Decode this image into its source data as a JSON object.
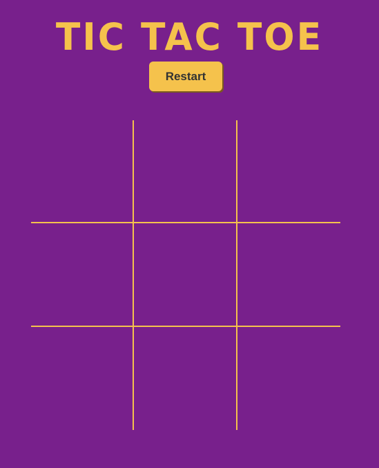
{
  "header": {
    "title": "TIC TAC TOE",
    "restart_label": "Restart"
  },
  "board": {
    "cells": [
      "",
      "",
      "",
      "",
      "",
      "",
      "",
      "",
      ""
    ]
  },
  "colors": {
    "background": "#78208c",
    "accent": "#f5c24c",
    "button_text": "#333333"
  }
}
